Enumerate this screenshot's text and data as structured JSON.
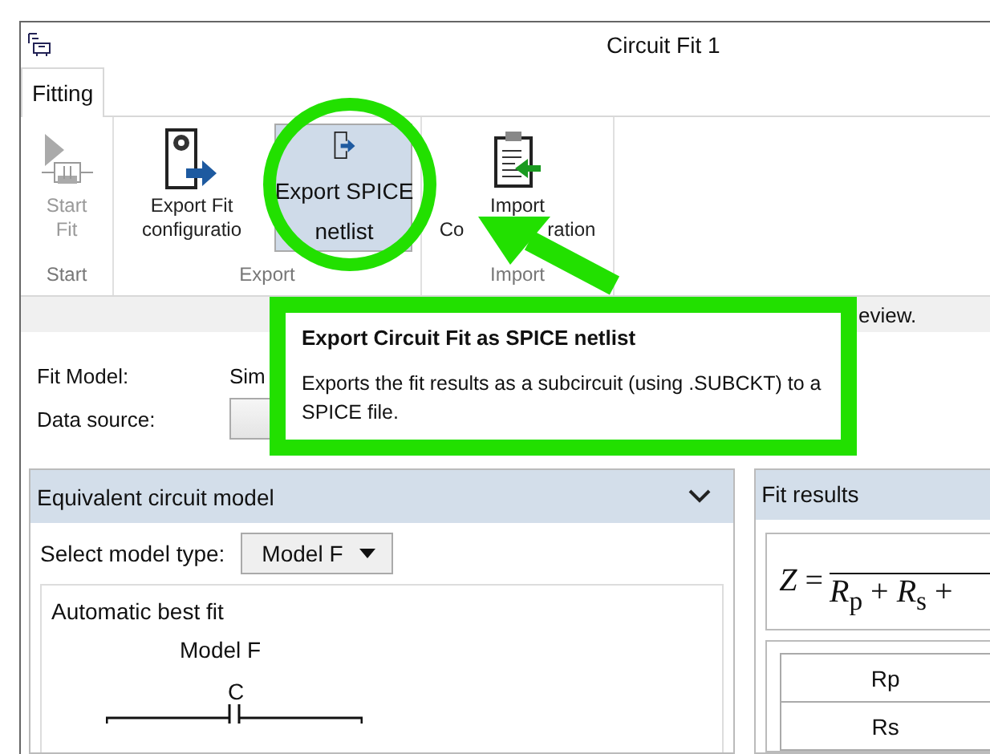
{
  "window": {
    "title": "Circuit Fit 1"
  },
  "tabs": [
    {
      "label": "Fitting",
      "selected": true
    }
  ],
  "ribbon_groups": [
    {
      "label": "Start",
      "buttons": [
        {
          "kind": "start",
          "lines": [
            [
              "Start"
            ],
            [
              "Fit"
            ]
          ],
          "disabled": true,
          "selected": false
        }
      ]
    },
    {
      "label": "Export",
      "buttons": [
        {
          "kind": "export-config",
          "lines": [
            [
              "Export Fit"
            ],
            [
              "configuratio"
            ]
          ],
          "disabled": false,
          "selected": false
        },
        {
          "kind": "export-netlist",
          "lines": [
            [
              "Export SPICE"
            ],
            [
              "netlist"
            ]
          ],
          "disabled": false,
          "selected": true
        }
      ]
    },
    {
      "label": "Import",
      "buttons": [
        {
          "kind": "import",
          "lines": [
            [
              "Import"
            ],
            [
              "Co",
              "ration"
            ]
          ],
          "disabled": false,
          "selected": false
        }
      ]
    }
  ],
  "info_bar": {
    "text": "eview."
  },
  "form": [
    {
      "kind": "text",
      "label": "Fit Model:",
      "value": "Sim"
    },
    {
      "kind": "dropdown",
      "label": "Data source:"
    }
  ],
  "tooltip": {
    "title": "Export Circuit Fit as SPICE netlist",
    "body": "Exports the fit results as a subcircuit (using .SUBCKT) to a SPICE file."
  },
  "model_panel": {
    "title": "Equivalent circuit model",
    "expanded": true,
    "select_label": "Select model type:",
    "select_value": "Model F",
    "diagram_title": "Automatic best fit",
    "model_name": "Model F",
    "component_label": "C"
  },
  "results_panel": {
    "title": "Fit results",
    "formula_lhs": "*Z* =",
    "formula_denominator": "*R*$_{p}$ + *R*$_{s}$ +",
    "table_rows": [
      "Rp",
      "Rs"
    ]
  }
}
